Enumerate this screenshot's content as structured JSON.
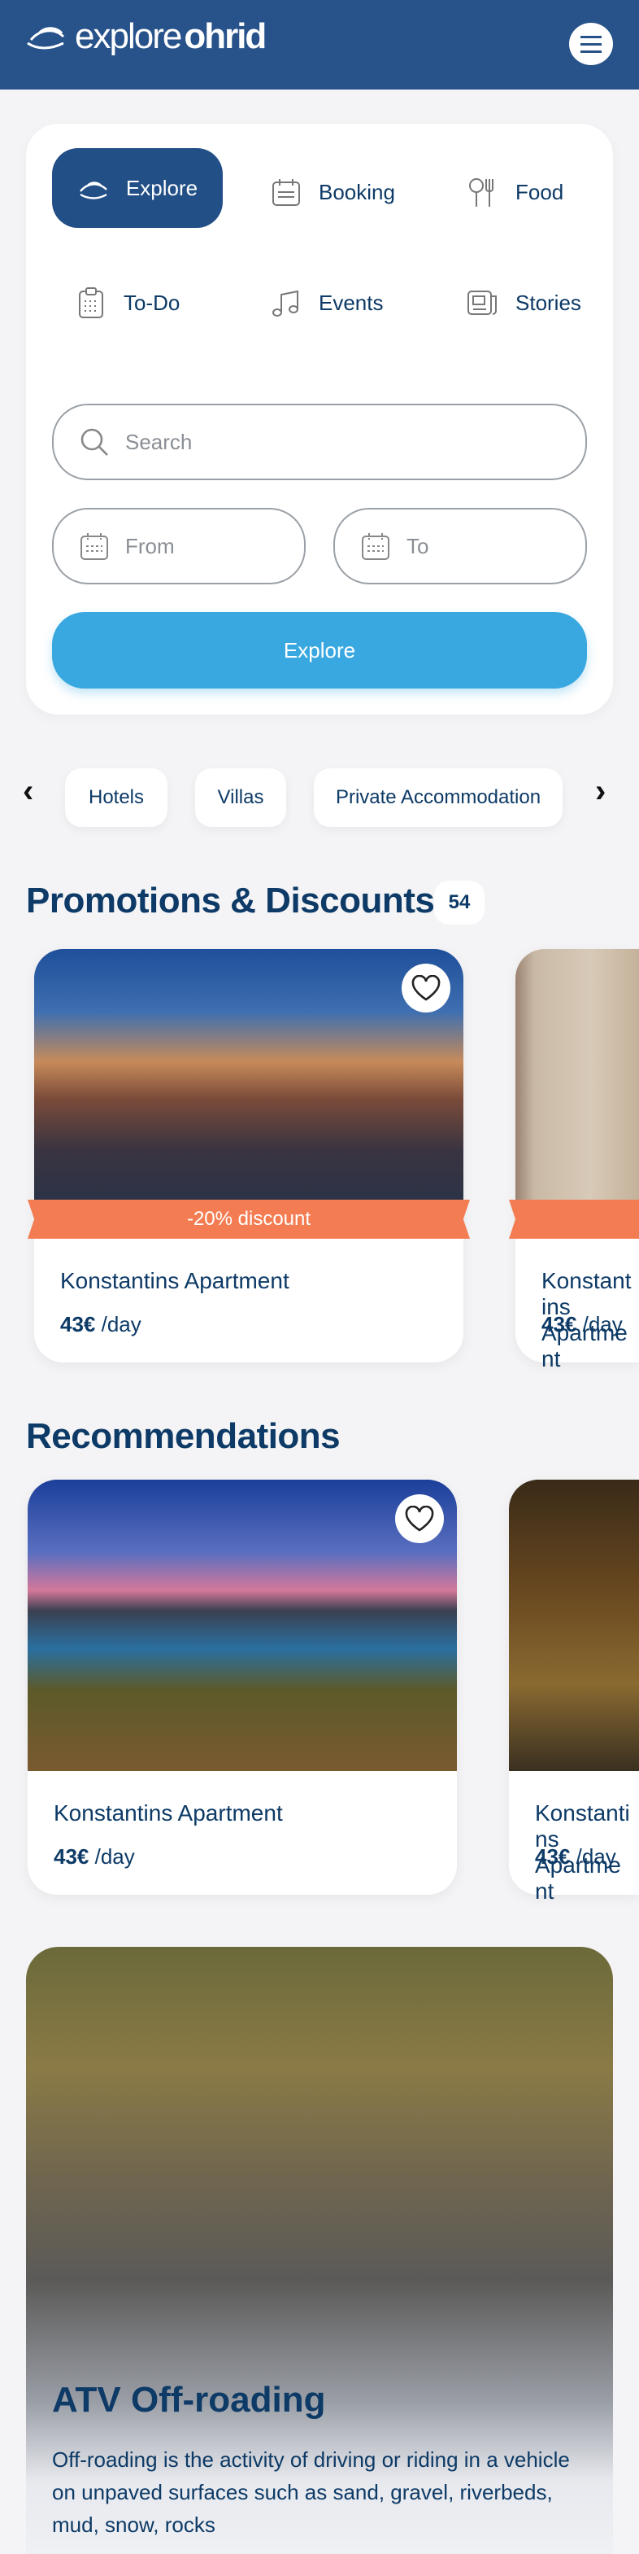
{
  "header": {
    "logo_light": "explore",
    "logo_bold": "ohrid",
    "menu_icon": "hamburger-icon"
  },
  "tabs": [
    {
      "label": "Explore",
      "icon": "explore-logo-icon",
      "active": true
    },
    {
      "label": "Booking",
      "icon": "calendar-icon"
    },
    {
      "label": "Food",
      "icon": "utensils-icon"
    },
    {
      "label": "To-Do",
      "icon": "clipboard-icon"
    },
    {
      "label": "Events",
      "icon": "music-note-icon"
    },
    {
      "label": "Stories",
      "icon": "newspaper-icon"
    }
  ],
  "search": {
    "placeholder": "Search",
    "from_placeholder": "From",
    "to_placeholder": "To",
    "button": "Explore"
  },
  "chips": [
    "Hotels",
    "Villas",
    "Private Accommodation"
  ],
  "promotions": {
    "title": "Promotions & Discounts",
    "count": "54",
    "cards": [
      {
        "discount": "-20% discount",
        "name": "Konstantins Apartment",
        "price": "43€",
        "unit": "/day"
      },
      {
        "discount": "",
        "name": "Konstantins Apartment",
        "price": "43€",
        "unit": "/day"
      }
    ]
  },
  "recommendations": {
    "title": "Recommendations",
    "cards": [
      {
        "name": "Konstantins Apartment",
        "price": "43€",
        "unit": "/day"
      },
      {
        "name": "Konstantins Apartment",
        "price": "43€",
        "unit": "/day"
      }
    ]
  },
  "feature": {
    "title": "ATV Off-roading",
    "description": "Off-roading is the activity of driving or riding in a vehicle on unpaved surfaces such as sand, gravel, riverbeds, mud, snow, rocks"
  },
  "colors": {
    "primary": "#27528a",
    "accent": "#3aa8e0",
    "discount": "#f47c52",
    "text": "#0d3a66"
  }
}
